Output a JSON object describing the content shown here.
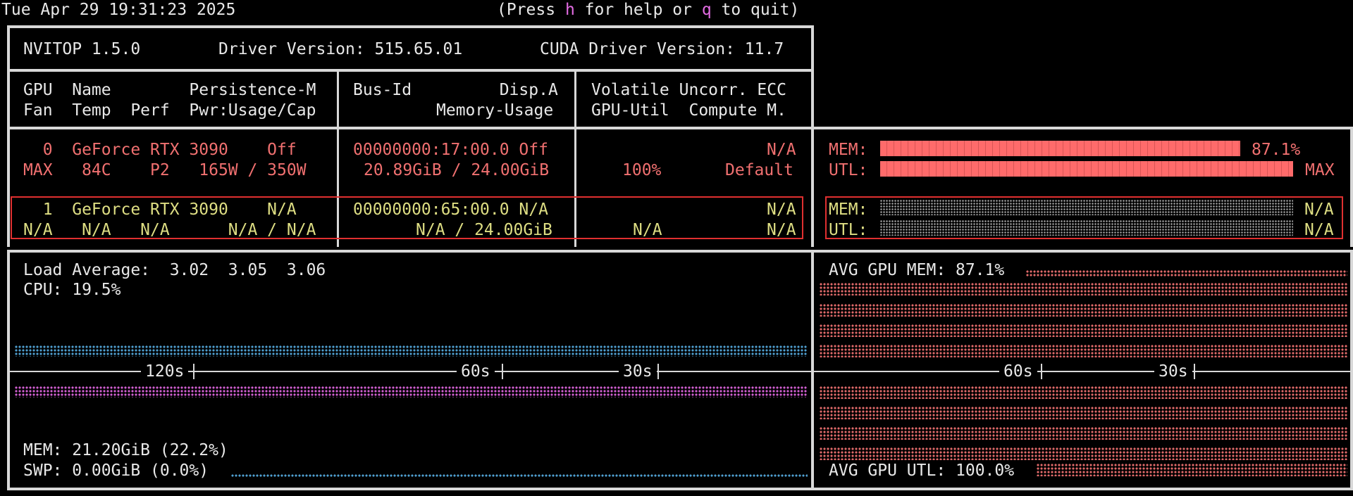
{
  "header": {
    "datetime": "Tue Apr 29 19:31:23 2025",
    "hint_pre": "(Press ",
    "hint_key1": "h",
    "hint_mid": " for help or ",
    "hint_key2": "q",
    "hint_post": " to quit)"
  },
  "info": {
    "version": "NVITOP 1.5.0",
    "driver_label": "Driver Version: 515.65.01",
    "cuda_label": "CUDA Driver Version: 11.7"
  },
  "columns": {
    "c1_row1": "GPU  Name        Persistence-M",
    "c1_row2": "Fan  Temp  Perf  Pwr:Usage/Cap",
    "c2_row1": "Bus-Id         Disp.A",
    "c2_row2": "Memory-Usage",
    "c3_row1": "Volatile Uncorr. ECC",
    "c3_row2": "GPU-Util  Compute M."
  },
  "gpus": [
    {
      "row1_left": "  0  GeForce RTX 3090    Off",
      "row2_left": "MAX   84C    P2   165W / 350W",
      "bus": "00000000:17:00.0 Off",
      "mem_usage": "20.89GiB / 24.00GiB",
      "ecc": "N/A",
      "util": "100%",
      "compute": "Default",
      "mem_label": "MEM:",
      "mem_pct": "87.1%",
      "mem_fraction": 0.871,
      "utl_label": "UTL:",
      "utl_pct": "MAX",
      "utl_fraction": 1.0
    },
    {
      "row1_left": "  1  GeForce RTX 3090    N/A",
      "row2_left": "N/A   N/A   N/A      N/A / N/A",
      "bus": "00000000:65:00.0 N/A",
      "mem_usage": "N/A / 24.00GiB",
      "ecc": "N/A",
      "util": "N/A",
      "compute": "N/A",
      "mem_label": "MEM:",
      "mem_pct": "N/A",
      "utl_label": "UTL:",
      "utl_pct": "N/A"
    }
  ],
  "host": {
    "load_avg": "Load Average:  3.02  3.05  3.06",
    "cpu": "CPU: 19.5%",
    "tick_120": "120s",
    "tick_60": "60s",
    "tick_30": "30s",
    "mem": "MEM: 21.20GiB (22.2%)",
    "swp": "SWP: 0.00GiB (0.0%)"
  },
  "gpu_avg": {
    "mem": "AVG GPU MEM: 87.1%",
    "tick_60": "60s",
    "tick_30": "30s",
    "utl": "AVG GPU UTL: 100.0%"
  },
  "colors": {
    "accent_red": "#f07070",
    "accent_yellow": "#dede83",
    "key_magenta": "#e36ce3",
    "cpu_blue": "#4f9fd0",
    "mem_magenta": "#d25fd2",
    "selection_red": "#e03030"
  }
}
